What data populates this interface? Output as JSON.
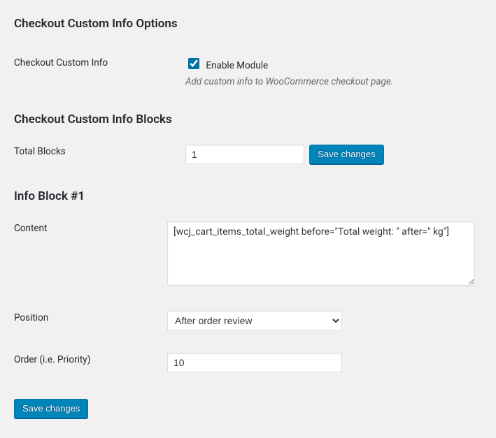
{
  "section1": {
    "heading": "Checkout Custom Info Options",
    "enable": {
      "label": "Checkout Custom Info",
      "checkbox_label": "Enable Module",
      "checked": true,
      "description": "Add custom info to WooCommerce checkout page."
    }
  },
  "section2": {
    "heading": "Checkout Custom Info Blocks",
    "total_blocks": {
      "label": "Total Blocks",
      "value": "1",
      "button": "Save changes"
    }
  },
  "section3": {
    "heading": "Info Block #1",
    "content": {
      "label": "Content",
      "value": "[wcj_cart_items_total_weight before=\"Total weight: \" after=\" kg\"]"
    },
    "position": {
      "label": "Position",
      "value": "After order review"
    },
    "order": {
      "label": "Order (i.e. Priority)",
      "value": "10"
    }
  },
  "bottom_save": "Save changes"
}
